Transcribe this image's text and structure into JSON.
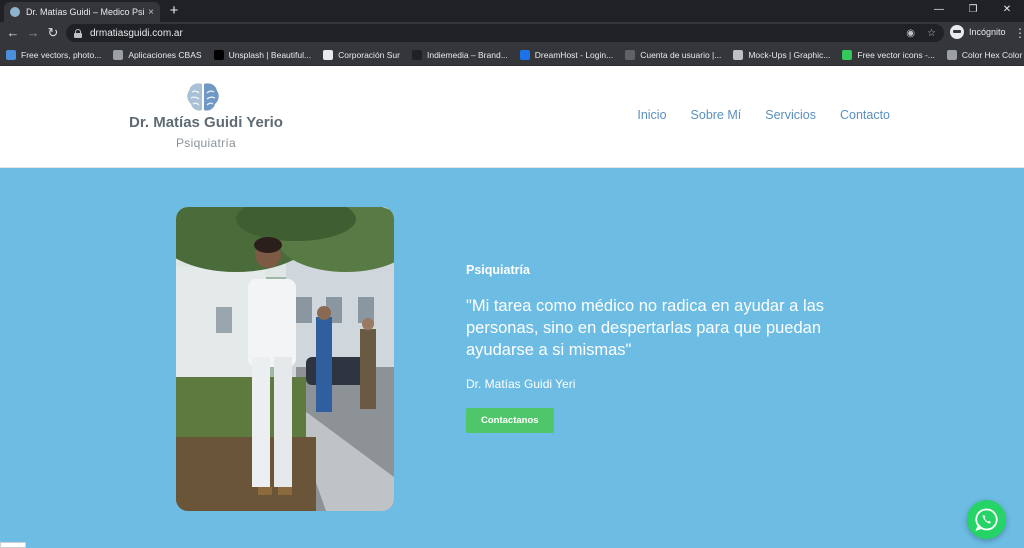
{
  "browser": {
    "tab_title": "Dr. Matías Guidi – Medico Psiqui...",
    "tab_close": "×",
    "new_tab": "+",
    "window_controls": [
      "—",
      "❐",
      "✕"
    ],
    "url": "drmatiasguidi.com.ar",
    "incognito_label": "Incógnito",
    "bookmarks": [
      {
        "label": "Free vectors, photo...",
        "color": "#4b8fdc"
      },
      {
        "label": "Aplicaciones CBAS",
        "color": "#9aa0a6"
      },
      {
        "label": "Unsplash | Beautiful...",
        "color": "#000000"
      },
      {
        "label": "Corporación Sur",
        "color": "#e8eaed"
      },
      {
        "label": "Indiemedia – Brand...",
        "color": "#202124"
      },
      {
        "label": "DreamHost - Login...",
        "color": "#1a73e8"
      },
      {
        "label": "Cuenta de usuario |...",
        "color": "#5f6368"
      },
      {
        "label": "Mock-Ups | Graphic...",
        "color": "#bdc1c6"
      },
      {
        "label": "Free vector icons -...",
        "color": "#34c759"
      },
      {
        "label": "Color Hex Color Co...",
        "color": "#9aa0a6"
      }
    ]
  },
  "site": {
    "brand_name": "Dr. Matías Guidi Yerio",
    "brand_sub": "Psiquiatría",
    "nav": [
      "Inicio",
      "Sobre Mí",
      "Servicios",
      "Contacto"
    ]
  },
  "hero": {
    "label": "Psiquiatría",
    "quote": "\"Mi tarea como médico no radica en ayudar a las personas, sino en despertarlas para que puedan ayudarse a si mismas\"",
    "author": "Dr. Matías Guidi Yeri",
    "button": "Contactanos"
  },
  "colors": {
    "hero_bg": "#6cbce3",
    "nav_link": "#5a8fbf",
    "button": "#4fc66a",
    "whatsapp": "#25d366"
  }
}
